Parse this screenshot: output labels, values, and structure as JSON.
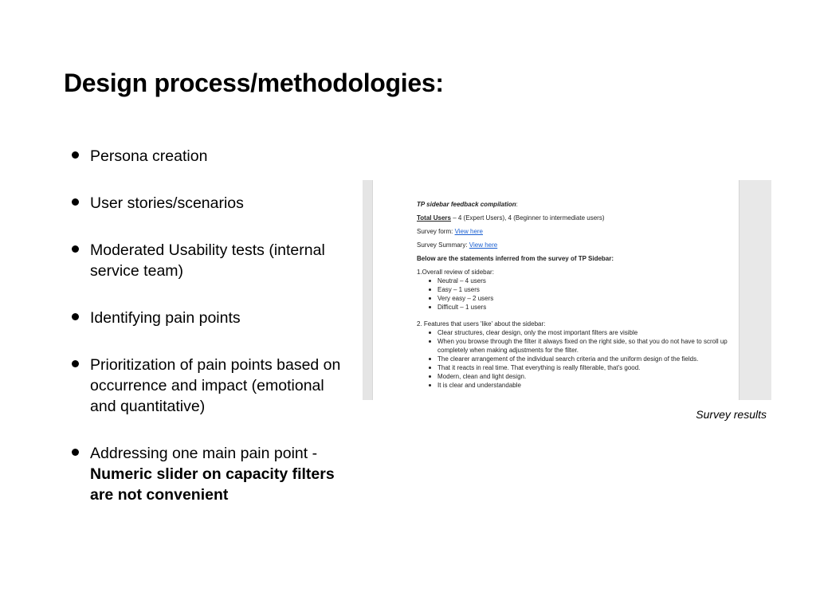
{
  "title": "Design process/methodologies:",
  "bullets": [
    {
      "text": "Persona creation"
    },
    {
      "text": "User stories/scenarios"
    },
    {
      "text": "Moderated Usability tests (internal service team)"
    },
    {
      "text": "Identifying pain points"
    },
    {
      "text": "Prioritization of pain points based on occurrence and impact (emotional and quantitative)"
    },
    {
      "text": "Addressing one main pain point - ",
      "bold": "Numeric slider on capacity filters are not convenient"
    }
  ],
  "survey": {
    "heading": "TP sidebar feedback compilation",
    "heading_suffix": ":",
    "total_users_label": "Total Users",
    "total_users_value": " – 4 (Expert Users), 4 (Beginner to intermediate users)",
    "survey_form_label": "Survey form: ",
    "survey_form_link": "View here",
    "survey_summary_label": "Survey Summary: ",
    "survey_summary_link": "View here",
    "statements_heading": "Below are the statements inferred from the survey of TP Sidebar:",
    "section1_title": "1.Overall review of sidebar:",
    "section1_items": [
      "Neutral – 4 users",
      "Easy – 1 users",
      "Very easy – 2 users",
      "Difficult – 1 users"
    ],
    "section2_title": "2. Features that users 'like' about the sidebar:",
    "section2_items": [
      "Clear structures, clear design, only the most important filters are visible",
      "When you browse through the filter it always fixed on the right side, so that you do not have to scroll up completely when making adjustments for the filter.",
      "The clearer arrangement of the individual search criteria and the uniform design of the fields.",
      "That it reacts in real time. That everything is really filterable, that's good.",
      "Modern, clean and light design.",
      "It is clear and understandable"
    ]
  },
  "caption": "Survey results"
}
